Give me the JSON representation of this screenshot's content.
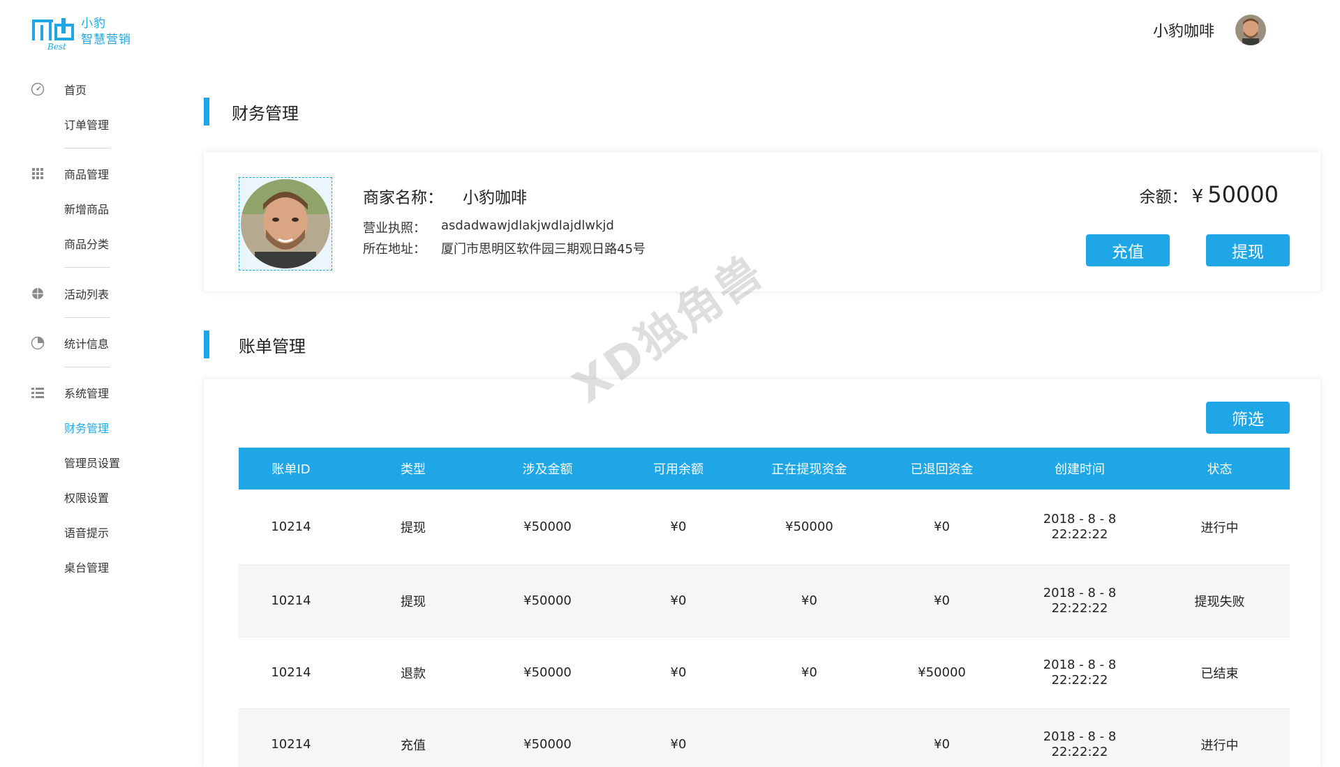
{
  "brand": {
    "logo_line1": "小豹",
    "logo_line2": "智慧营销",
    "logo_mark": "Best"
  },
  "header": {
    "user_name": "小豹咖啡"
  },
  "sidebar": {
    "items": [
      {
        "label": "首页",
        "icon": "dashboard-icon"
      },
      {
        "label": "订单管理"
      },
      {
        "label": "商品管理",
        "icon": "grid-icon"
      },
      {
        "label": "新增商品"
      },
      {
        "label": "商品分类"
      },
      {
        "label": "活动列表",
        "icon": "globe-icon"
      },
      {
        "label": "统计信息",
        "icon": "pie-chart-icon"
      },
      {
        "label": "系统管理",
        "icon": "list-icon"
      },
      {
        "label": "财务管理",
        "active": true
      },
      {
        "label": "管理员设置"
      },
      {
        "label": "权限设置"
      },
      {
        "label": "语音提示"
      },
      {
        "label": "桌台管理"
      }
    ]
  },
  "finance": {
    "title": "财务管理",
    "merchant_label": "商家名称：",
    "merchant_name": "小豹咖啡",
    "license_label": "营业执照：",
    "license_value": "asdadwawjdlakjwdlajdlwkjd",
    "address_label": "所在地址：",
    "address_value": "厦门市思明区软件园三期观日路45号",
    "balance_label": "余额：",
    "currency": "¥",
    "balance_value": "50000",
    "recharge_label": "充值",
    "withdraw_label": "提现"
  },
  "bills": {
    "title": "账单管理",
    "filter_label": "筛选",
    "columns": [
      "账单ID",
      "类型",
      "涉及金额",
      "可用余额",
      "正在提现资金",
      "已退回资金",
      "创建时间",
      "状态"
    ],
    "rows": [
      {
        "id": "10214",
        "type": "提现",
        "amount": "¥50000",
        "available": "¥0",
        "withdrawing": "¥50000",
        "returned": "¥0",
        "date": "2018 - 8 - 8",
        "time": "22:22:22",
        "status": "进行中",
        "status_color": "#2e9a2e"
      },
      {
        "id": "10214",
        "type": "提现",
        "amount": "¥50000",
        "available": "¥0",
        "withdrawing": "¥0",
        "returned": "¥0",
        "date": "2018 - 8 - 8",
        "time": "22:22:22",
        "status": "提现失败",
        "status_color": "#e0221f"
      },
      {
        "id": "10214",
        "type": "退款",
        "amount": "¥50000",
        "available": "¥0",
        "withdrawing": "¥0",
        "returned": "¥50000",
        "date": "2018 - 8 - 8",
        "time": "22:22:22",
        "status": "已结束",
        "status_color": "#222222"
      },
      {
        "id": "10214",
        "type": "充值",
        "amount": "¥50000",
        "available": "¥0",
        "withdrawing": "",
        "returned": "¥0",
        "date": "2018 - 8 - 8",
        "time": "22:22:22",
        "status": "进行中",
        "status_color": "#2e9a2e"
      }
    ]
  },
  "watermark": "XD独角兽",
  "colors": {
    "accent": "#1ea6e6",
    "status_green": "#2e9a2e",
    "status_red": "#e0221f"
  }
}
